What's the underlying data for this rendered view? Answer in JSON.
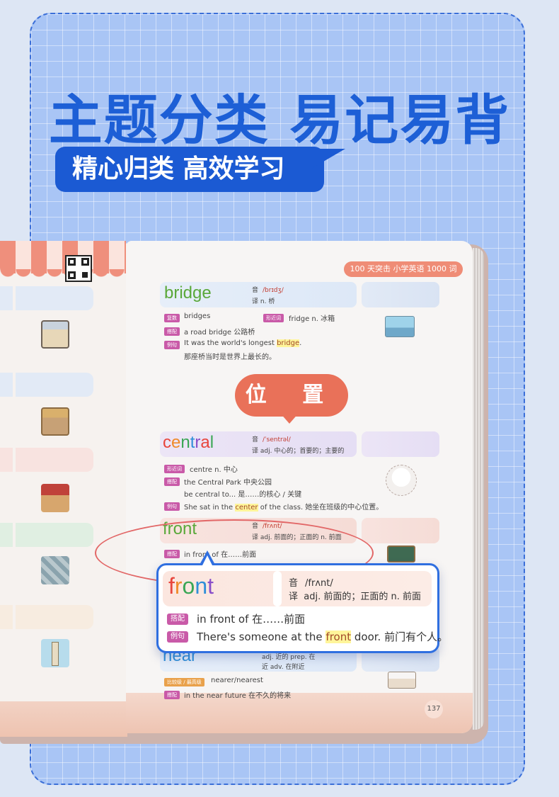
{
  "headline": "主题分类 易记易背",
  "subtag": "精心归类 高效学习",
  "book": {
    "header_tag": "100 天突击 小学英语 1000 词",
    "section_title": "位 置",
    "page_number": "137",
    "entries": {
      "bridge": {
        "word": "bridge",
        "phonetic_label": "音",
        "phonetic": "/brɪdʒ/",
        "meaning_label": "译",
        "meaning": "n. 桥",
        "plural_badge": "复数",
        "plural": "bridges",
        "similar_badge": "形近词",
        "similar": "fridge n. 冰箱",
        "collocation_badge": "搭配",
        "collocation": "a road bridge 公路桥",
        "example_badge": "例句",
        "example_pre": "It was the world's longest ",
        "example_hl": "bridge",
        "example_post": ".",
        "example_cn": "那座桥当时是世界上最长的。"
      },
      "central": {
        "word": "central",
        "phonetic_label": "音",
        "phonetic": "/ˈsentrəl/",
        "meaning_label": "译",
        "meaning": "adj. 中心的；首要的；主要的",
        "similar_badge": "形近词",
        "similar": "centre n. 中心",
        "collocation_badge": "搭配",
        "collocation1": "the Central Park 中央公园",
        "collocation2": "be central to... 是……的核心 / 关键",
        "example_badge": "例句",
        "example_pre": "She sat in the ",
        "example_hl": "center",
        "example_post": " of the class. 她坐在班级的中心位置。"
      },
      "front_small": {
        "word": "front",
        "phonetic_label": "音",
        "phonetic": "/frʌnt/",
        "meaning_label": "译",
        "meaning": "adj. 前面的；正面的 n. 前面",
        "collocation_badge": "搭配",
        "collocation": "in front of 在……前面"
      },
      "near": {
        "word": "near",
        "meaning_a": "adj. 近的 prep. 在",
        "meaning_b": "近 adv. 在附近",
        "compare_badge": "比较级 / 最高级",
        "compare": "nearer/nearest",
        "collocation_badge": "搭配",
        "collocation": "in the near future 在不久的将来"
      }
    }
  },
  "zoom": {
    "word_letters": [
      "f",
      "r",
      "o",
      "n",
      "t"
    ],
    "phonetic_label": "音",
    "phonetic": "/frʌnt/",
    "meaning_label": "译",
    "meaning": "adj. 前面的；正面的 n. 前面",
    "collocation_badge": "搭配",
    "collocation": "in front of 在……前面",
    "example_badge": "例句",
    "example_pre": "There's someone at the ",
    "example_hl": "front",
    "example_post": " door. 前门有个人。"
  },
  "colors": {
    "brand_blue": "#1d5fd6",
    "accent_red": "#e97159",
    "badge_purple": "#c95aa8",
    "rainbow": [
      "#e8453c",
      "#f08a2a",
      "#3aa655",
      "#2f8fd8",
      "#8a4fc9"
    ]
  }
}
